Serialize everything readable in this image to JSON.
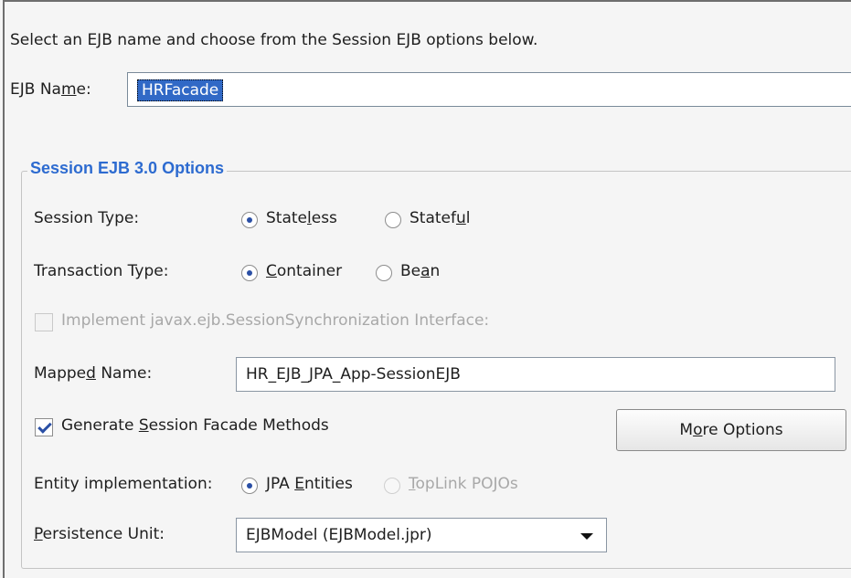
{
  "instruction": "Select an EJB name and choose from the Session EJB options below.",
  "ejb_name": {
    "label_pre": "EJB Na",
    "label_ul": "m",
    "label_post": "e:",
    "value": "HRFacade"
  },
  "group_title": "Session EJB 3.0 Options",
  "session_type": {
    "label": "Session Type:",
    "stateless": {
      "pre": "State",
      "ul": "l",
      "post": "ess",
      "selected": true
    },
    "stateful": {
      "pre": "Statef",
      "ul": "u",
      "post": "l",
      "selected": false
    }
  },
  "transaction_type": {
    "label": "Transaction Type:",
    "container": {
      "pre": "",
      "ul": "C",
      "post": "ontainer",
      "selected": true
    },
    "bean": {
      "pre": "Be",
      "ul": "a",
      "post": "n",
      "selected": false
    }
  },
  "session_sync": {
    "label": "Implement javax.ejb.SessionSynchronization Interface:",
    "checked": false,
    "enabled": false
  },
  "mapped_name": {
    "label_pre": "Mappe",
    "label_ul": "d",
    "label_post": " Name:",
    "value": "HR_EJB_JPA_App-SessionEJB"
  },
  "generate_facade": {
    "pre": "Generate ",
    "ul": "S",
    "post": "ession Facade Methods",
    "checked": true
  },
  "more_options": {
    "pre": "M",
    "ul": "o",
    "post": "re Options"
  },
  "entity_impl": {
    "label": "Entity implementation:",
    "jpa": {
      "pre": "JPA ",
      "ul": "E",
      "post": "ntities",
      "selected": true
    },
    "toplink": {
      "pre": "",
      "ul": "T",
      "post": "opLink POJOs",
      "selected": false,
      "enabled": false
    }
  },
  "persistence_unit": {
    "label_pre": "",
    "label_ul": "P",
    "label_post": "ersistence Unit:",
    "value": "EJBModel (EJBModel.jpr)"
  },
  "colors": {
    "group_title": "#2d6bd0",
    "selection": "#3169c6",
    "disabled": "#a8a8a8"
  }
}
